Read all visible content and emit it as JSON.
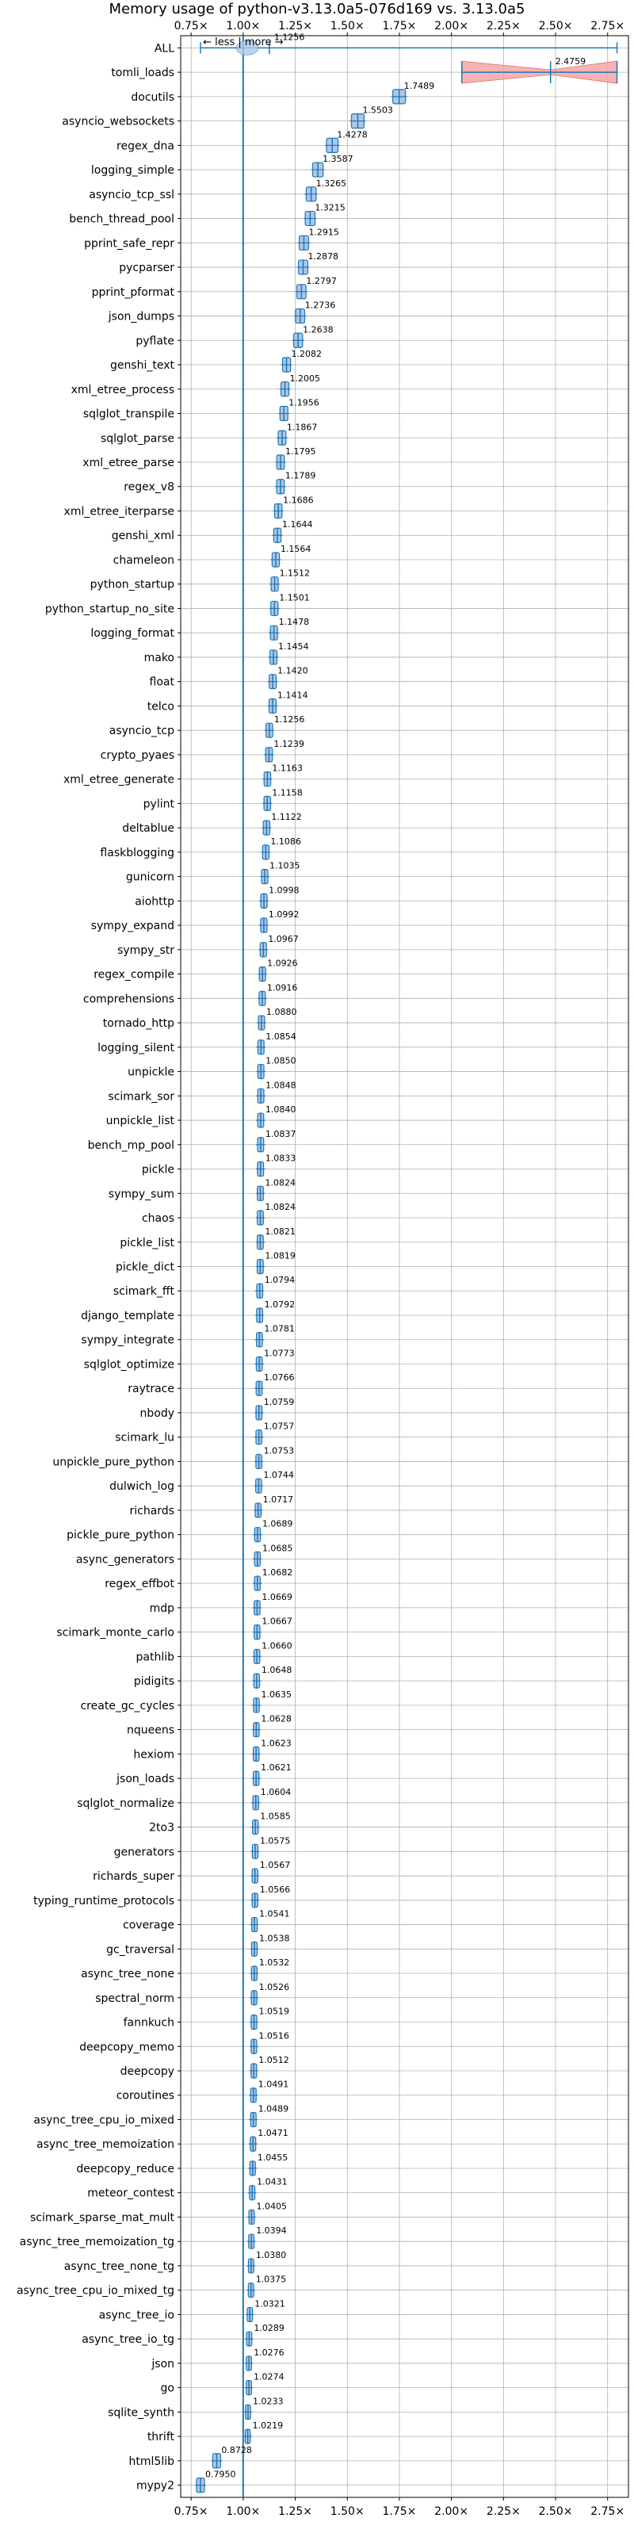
{
  "chart_data": {
    "type": "violin-horizontal",
    "title": "Memory usage of python-v3.13.0a5-076d169 vs. 3.13.0a5",
    "direction_hint": "← less | more →",
    "xlim": [
      0.7,
      2.85
    ],
    "xticks": [
      0.75,
      1.0,
      1.25,
      1.5,
      1.75,
      2.0,
      2.25,
      2.5,
      2.75
    ],
    "xtick_labels": [
      "0.75×",
      "1.00×",
      "1.25×",
      "1.50×",
      "1.75×",
      "2.00×",
      "2.25×",
      "2.50×",
      "2.75×"
    ],
    "reference_line": 1.0,
    "grid": true,
    "colors": {
      "normal": "#1f77b4",
      "violin": "#aec7e8",
      "regression": "#f4a6a6",
      "regression_edge": "#e07070"
    },
    "categories": [
      "ALL",
      "tomli_loads",
      "docutils",
      "asyncio_websockets",
      "regex_dna",
      "logging_simple",
      "asyncio_tcp_ssl",
      "bench_thread_pool",
      "pprint_safe_repr",
      "pycparser",
      "pprint_pformat",
      "json_dumps",
      "pyflate",
      "genshi_text",
      "xml_etree_process",
      "sqlglot_transpile",
      "sqlglot_parse",
      "xml_etree_parse",
      "regex_v8",
      "xml_etree_iterparse",
      "genshi_xml",
      "chameleon",
      "python_startup",
      "python_startup_no_site",
      "logging_format",
      "mako",
      "float",
      "telco",
      "asyncio_tcp",
      "crypto_pyaes",
      "xml_etree_generate",
      "pylint",
      "deltablue",
      "flaskblogging",
      "gunicorn",
      "aiohttp",
      "sympy_expand",
      "sympy_str",
      "regex_compile",
      "comprehensions",
      "tornado_http",
      "logging_silent",
      "unpickle",
      "scimark_sor",
      "unpickle_list",
      "bench_mp_pool",
      "pickle",
      "sympy_sum",
      "chaos",
      "pickle_list",
      "pickle_dict",
      "scimark_fft",
      "django_template",
      "sympy_integrate",
      "sqlglot_optimize",
      "raytrace",
      "nbody",
      "scimark_lu",
      "unpickle_pure_python",
      "dulwich_log",
      "richards",
      "pickle_pure_python",
      "async_generators",
      "regex_effbot",
      "mdp",
      "scimark_monte_carlo",
      "pathlib",
      "pidigits",
      "create_gc_cycles",
      "nqueens",
      "hexiom",
      "json_loads",
      "sqlglot_normalize",
      "2to3",
      "generators",
      "richards_super",
      "typing_runtime_protocols",
      "coverage",
      "gc_traversal",
      "async_tree_none",
      "spectral_norm",
      "fannkuch",
      "deepcopy_memo",
      "deepcopy",
      "coroutines",
      "async_tree_cpu_io_mixed",
      "async_tree_memoization",
      "deepcopy_reduce",
      "meteor_contest",
      "scimark_sparse_mat_mult",
      "async_tree_memoization_tg",
      "async_tree_none_tg",
      "async_tree_cpu_io_mixed_tg",
      "async_tree_io",
      "async_tree_io_tg",
      "json",
      "go",
      "sqlite_synth",
      "thrift",
      "html5lib",
      "mypy2"
    ],
    "values": [
      1.1256,
      2.4759,
      1.7489,
      1.5503,
      1.4278,
      1.3587,
      1.3265,
      1.3215,
      1.2915,
      1.2878,
      1.2797,
      1.2736,
      1.2638,
      1.2082,
      1.2005,
      1.1956,
      1.1867,
      1.1795,
      1.1789,
      1.1686,
      1.1644,
      1.1564,
      1.1512,
      1.1501,
      1.1478,
      1.1454,
      1.142,
      1.1414,
      1.1256,
      1.1239,
      1.1163,
      1.1158,
      1.1122,
      1.1086,
      1.1035,
      1.0998,
      1.0992,
      1.0967,
      1.0926,
      1.0916,
      1.088,
      1.0854,
      1.085,
      1.0848,
      1.084,
      1.0837,
      1.0833,
      1.0824,
      1.0824,
      1.0821,
      1.0819,
      1.0794,
      1.0792,
      1.0781,
      1.0773,
      1.0766,
      1.0759,
      1.0757,
      1.0753,
      1.0744,
      1.0717,
      1.0689,
      1.0685,
      1.0682,
      1.0669,
      1.0667,
      1.066,
      1.0648,
      1.0635,
      1.0628,
      1.0623,
      1.0621,
      1.0604,
      1.0585,
      1.0575,
      1.0567,
      1.0566,
      1.0541,
      1.0538,
      1.0532,
      1.0526,
      1.0519,
      1.0516,
      1.0512,
      1.0491,
      1.0489,
      1.0471,
      1.0455,
      1.0431,
      1.0405,
      1.0394,
      1.038,
      1.0375,
      1.0321,
      1.0289,
      1.0276,
      1.0274,
      1.0233,
      1.0219,
      0.8728,
      0.795
    ],
    "all_range": [
      0.795,
      2.795
    ],
    "tomli_range": [
      2.05,
      2.795
    ]
  }
}
